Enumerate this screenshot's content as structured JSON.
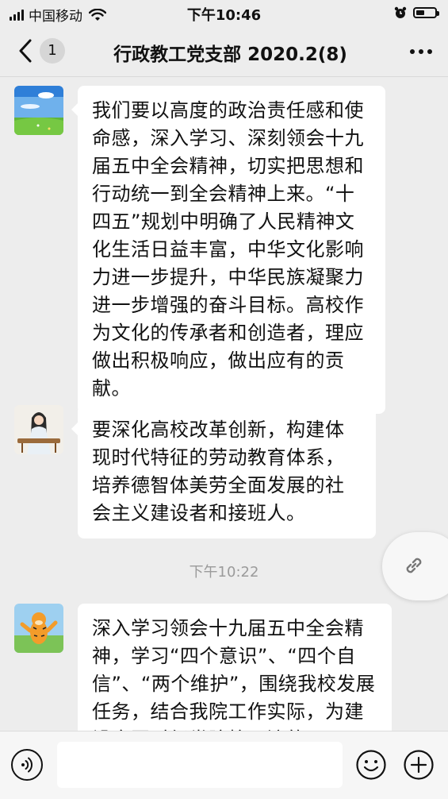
{
  "status": {
    "carrier": "中国移动",
    "time": "下午10:46"
  },
  "nav": {
    "back_badge": "1",
    "title": "行政教工党支部 2020.2(8)"
  },
  "messages": [
    {
      "avatar": "sky-field-avatar",
      "text": "我们要以高度的政治责任感和使命感，深入学习、深刻领会十九届五中全会精神，切实把思想和行动统一到全会精神上来。“十四五”规划中明确了人民精神文化生活日益丰富，中华文化影响力进一步提升，中华民族凝聚力进一步增强的奋斗目标。高校作为文化的传承者和创造者，理应做出积极响应，做出应有的贡献。"
    },
    {
      "avatar": "girl-guzheng-avatar",
      "text": "要深化高校改革创新，构建体现时代特征的劳动教育体系，培养德智体美劳全面发展的社会主义建设者和接班人。"
    },
    {
      "avatar": "tigger-avatar",
      "text": "深入学习领会十九届五中全会精神，学习“四个意识”、“四个自信”、“两个维护”，围绕我校发展任务，结合我院工作实际，为建设全国财经类院校一流的"
    }
  ],
  "timestamp": "下午10:22",
  "colors": {
    "background": "#ededed",
    "bubble": "#ffffff",
    "timestamp": "#9b9b9b"
  }
}
